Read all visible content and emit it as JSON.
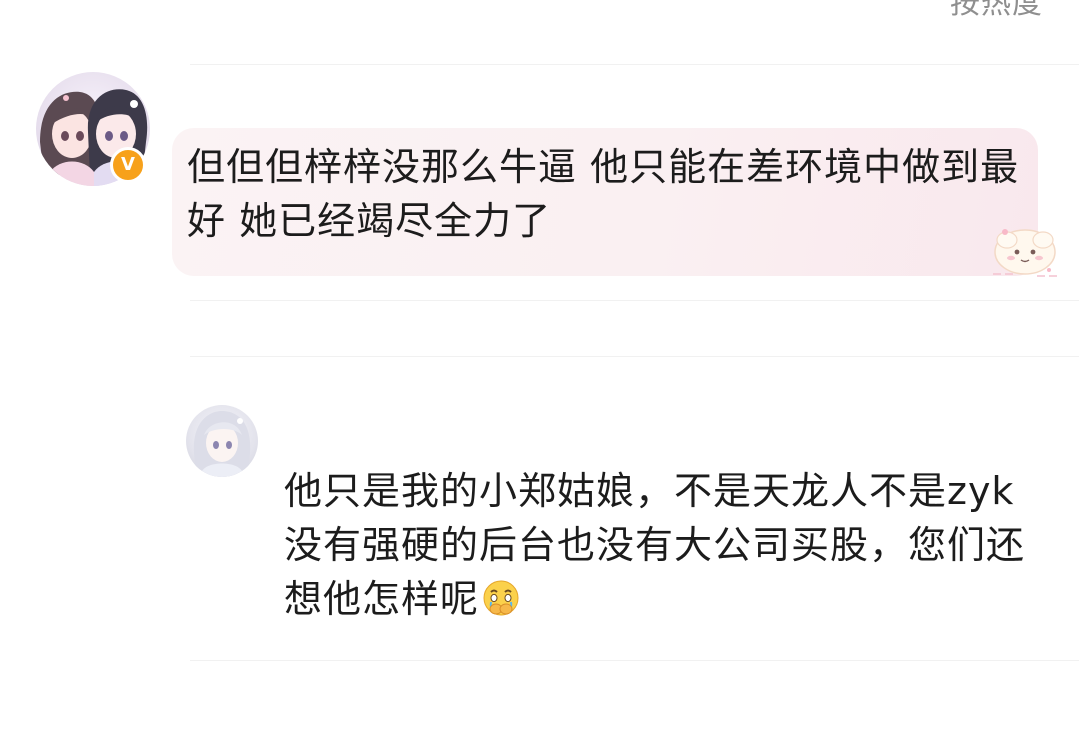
{
  "header": {
    "sort_label": "按热度"
  },
  "comment": {
    "avatar_icon": "anime-girls-avatar-icon",
    "verified_badge": "V",
    "badge_color": "#f7a11b",
    "text": "但但但梓梓没那么牛逼 他只能在差环境中做到最好 她已经竭尽全力了",
    "bubble_sticker_icon": "cute-sticker-icon"
  },
  "reply": {
    "avatar_icon": "anime-girl-avatar-icon",
    "text": "他只是我的小郑姑娘，不是天龙人不是zyk没有强硬的后台也没有大公司买股，您们还想他怎样呢",
    "emoji_icon": "crying-hands-over-mouth-emoji-icon"
  }
}
